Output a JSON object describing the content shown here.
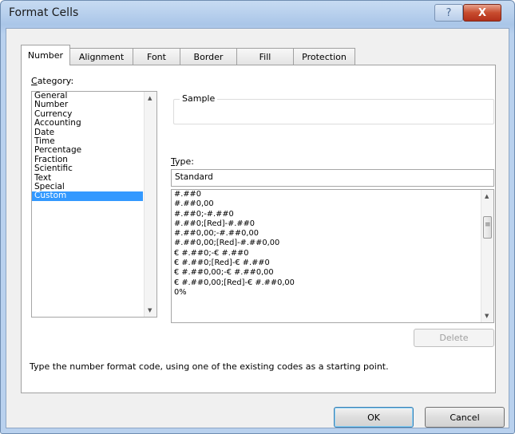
{
  "window": {
    "title": "Format Cells",
    "help_label": "?",
    "close_label": "X"
  },
  "tabs": [
    {
      "label": "Number"
    },
    {
      "label": "Alignment"
    },
    {
      "label": "Font"
    },
    {
      "label": "Border"
    },
    {
      "label": "Fill"
    },
    {
      "label": "Protection"
    }
  ],
  "category": {
    "label_first": "C",
    "label_rest": "ategory:",
    "items": [
      "General",
      "Number",
      "Currency",
      "Accounting",
      "Date",
      "Time",
      "Percentage",
      "Fraction",
      "Scientific",
      "Text",
      "Special",
      "Custom"
    ],
    "selected": "Custom"
  },
  "sample": {
    "label": "Sample",
    "value": ""
  },
  "type": {
    "label_first": "T",
    "label_rest": "ype:",
    "value": "Standard",
    "formats": [
      "#.##0",
      "#.##0,00",
      "#.##0;-#.##0",
      "#.##0;[Red]-#.##0",
      "#.##0,00;-#.##0,00",
      "#.##0,00;[Red]-#.##0,00",
      "€ #.##0;-€ #.##0",
      "€ #.##0;[Red]-€ #.##0",
      "€ #.##0,00;-€ #.##0,00",
      "€ #.##0,00;[Red]-€ #.##0,00",
      "0%"
    ]
  },
  "buttons": {
    "delete": "Delete",
    "ok": "OK",
    "cancel": "Cancel"
  },
  "hint": "Type the number format code, using one of the existing codes as a starting point."
}
